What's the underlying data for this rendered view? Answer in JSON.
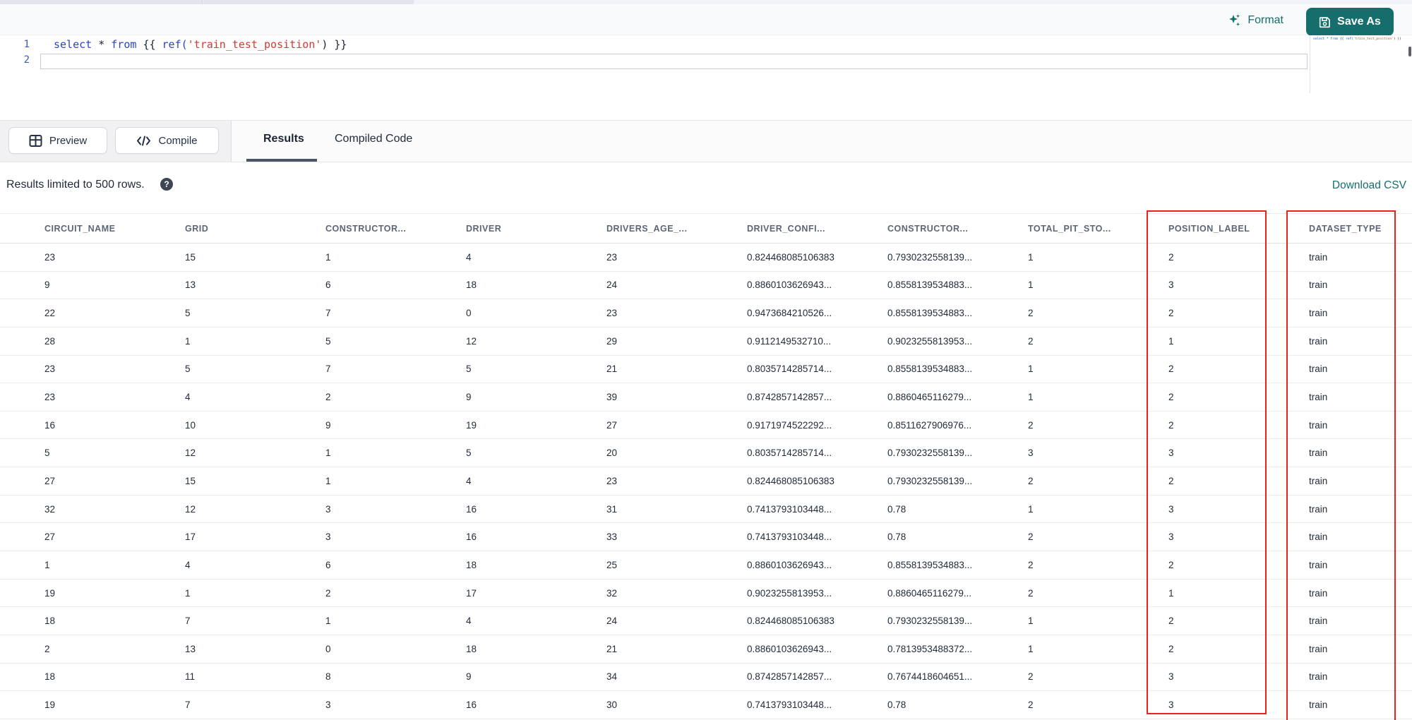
{
  "colors": {
    "teal": "#156e6c",
    "highlight_red": "#e8231d",
    "code_keyword": "#2b44c4",
    "code_string": "#d43a31",
    "code_plain": "#1a2230",
    "line_number": "#3b5bb5",
    "tab_underline": "#4a5565"
  },
  "toolbar": {
    "format_label": "Format",
    "save_as_label": "Save As"
  },
  "editor": {
    "line1_number": "1",
    "line2_number": "2",
    "tokens": [
      {
        "t": "select ",
        "c": "kw"
      },
      {
        "t": "* ",
        "c": "op"
      },
      {
        "t": "from ",
        "c": "kw"
      },
      {
        "t": "{{ ",
        "c": "plain"
      },
      {
        "t": "ref(",
        "c": "fn"
      },
      {
        "t": "'train_test_position'",
        "c": "str"
      },
      {
        "t": ") ",
        "c": "plain"
      },
      {
        "t": "}}",
        "c": "plain"
      }
    ]
  },
  "actions": {
    "preview_label": "Preview",
    "compile_label": "Compile"
  },
  "tabs": {
    "results": "Results",
    "compiled_code": "Compiled Code"
  },
  "results_bar": {
    "info": "Results limited to 500 rows.",
    "help_glyph": "?",
    "download_label": "Download CSV"
  },
  "table": {
    "columns": [
      "CIRCUIT_NAME",
      "GRID",
      "CONSTRUCTOR...",
      "DRIVER",
      "DRIVERS_AGE_...",
      "DRIVER_CONFI...",
      "CONSTRUCTOR...",
      "TOTAL_PIT_STO...",
      "POSITION_LABEL",
      "DATASET_TYPE"
    ],
    "rows": [
      [
        "23",
        "15",
        "1",
        "4",
        "23",
        "0.824468085106383",
        "0.7930232558139...",
        "1",
        "2",
        "train"
      ],
      [
        "9",
        "13",
        "6",
        "18",
        "24",
        "0.8860103626943...",
        "0.8558139534883...",
        "1",
        "3",
        "train"
      ],
      [
        "22",
        "5",
        "7",
        "0",
        "23",
        "0.9473684210526...",
        "0.8558139534883...",
        "2",
        "2",
        "train"
      ],
      [
        "28",
        "1",
        "5",
        "12",
        "29",
        "0.9112149532710...",
        "0.9023255813953...",
        "2",
        "1",
        "train"
      ],
      [
        "23",
        "5",
        "7",
        "5",
        "21",
        "0.8035714285714...",
        "0.8558139534883...",
        "1",
        "2",
        "train"
      ],
      [
        "23",
        "4",
        "2",
        "9",
        "39",
        "0.8742857142857...",
        "0.8860465116279...",
        "1",
        "2",
        "train"
      ],
      [
        "16",
        "10",
        "9",
        "19",
        "27",
        "0.9171974522292...",
        "0.8511627906976...",
        "2",
        "2",
        "train"
      ],
      [
        "5",
        "12",
        "1",
        "5",
        "20",
        "0.8035714285714...",
        "0.7930232558139...",
        "3",
        "3",
        "train"
      ],
      [
        "27",
        "15",
        "1",
        "4",
        "23",
        "0.824468085106383",
        "0.7930232558139...",
        "2",
        "2",
        "train"
      ],
      [
        "32",
        "12",
        "3",
        "16",
        "31",
        "0.7413793103448...",
        "0.78",
        "1",
        "3",
        "train"
      ],
      [
        "27",
        "17",
        "3",
        "16",
        "33",
        "0.7413793103448...",
        "0.78",
        "2",
        "3",
        "train"
      ],
      [
        "1",
        "4",
        "6",
        "18",
        "25",
        "0.8860103626943...",
        "0.8558139534883...",
        "2",
        "2",
        "train"
      ],
      [
        "19",
        "1",
        "2",
        "17",
        "32",
        "0.9023255813953...",
        "0.8860465116279...",
        "2",
        "1",
        "train"
      ],
      [
        "18",
        "7",
        "1",
        "4",
        "24",
        "0.824468085106383",
        "0.7930232558139...",
        "1",
        "2",
        "train"
      ],
      [
        "2",
        "13",
        "0",
        "18",
        "21",
        "0.8860103626943...",
        "0.7813953488372...",
        "1",
        "2",
        "train"
      ],
      [
        "18",
        "11",
        "8",
        "9",
        "34",
        "0.8742857142857...",
        "0.7674418604651...",
        "2",
        "3",
        "train"
      ],
      [
        "19",
        "7",
        "3",
        "16",
        "30",
        "0.7413793103448...",
        "0.78",
        "2",
        "3",
        "train"
      ]
    ],
    "highlighted_columns": [
      "POSITION_LABEL",
      "DATASET_TYPE"
    ]
  }
}
